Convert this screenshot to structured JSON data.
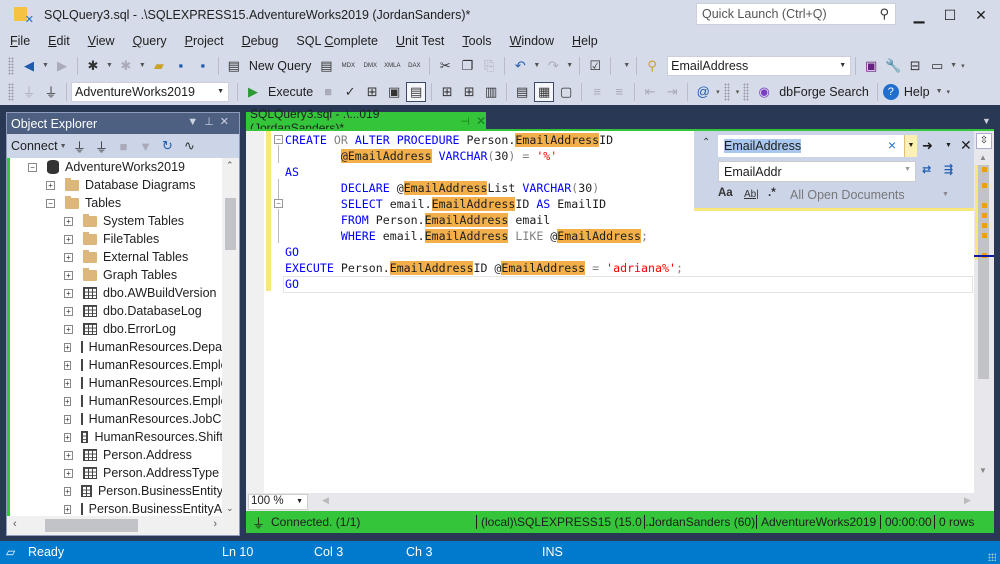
{
  "window": {
    "title": "SQLQuery3.sql - .\\SQLEXPRESS15.AdventureWorks2019 (JordanSanders)*",
    "quick_launch_placeholder": "Quick Launch (Ctrl+Q)",
    "minimize": "▁",
    "maximize": "☐",
    "close": "✕"
  },
  "menu": [
    {
      "label": "File",
      "access": "F",
      "rest": "ile"
    },
    {
      "label": "Edit",
      "access": "E",
      "rest": "dit"
    },
    {
      "label": "View",
      "access": "V",
      "rest": "iew"
    },
    {
      "label": "Query",
      "access": "Q",
      "rest": "uery"
    },
    {
      "label": "Project",
      "access": "P",
      "rest": "roject"
    },
    {
      "label": "Debug",
      "access": "D",
      "rest": "ebug"
    },
    {
      "label": "SQL Complete",
      "pre": "SQL ",
      "access": "C",
      "rest": "omplete"
    },
    {
      "label": "Unit Test",
      "access": "U",
      "rest": "nit Test"
    },
    {
      "label": "Tools",
      "access": "T",
      "rest": "ools"
    },
    {
      "label": "Window",
      "access": "W",
      "rest": "indow"
    },
    {
      "label": "Help",
      "access": "H",
      "rest": "elp"
    }
  ],
  "toolbar1": {
    "new_query": "New Query",
    "find_combo": "EmailAddress",
    "icons": {
      "mdx": "MDX",
      "dmx": "DMX",
      "xmla": "XMLA",
      "dax": "DAX"
    }
  },
  "toolbar2": {
    "database": "AdventureWorks2019",
    "execute": "Execute",
    "dbforge_search": "dbForge Search",
    "help": "Help"
  },
  "object_explorer": {
    "title": "Object Explorer",
    "connect": "Connect",
    "tree": [
      {
        "label": "AdventureWorks2019",
        "level": 0,
        "expander": "−",
        "icon": "database"
      },
      {
        "label": "Database Diagrams",
        "level": 1,
        "expander": "+",
        "icon": "folder"
      },
      {
        "label": "Tables",
        "level": 1,
        "expander": "−",
        "icon": "folder"
      },
      {
        "label": "System Tables",
        "level": 2,
        "expander": "+",
        "icon": "folder"
      },
      {
        "label": "FileTables",
        "level": 2,
        "expander": "+",
        "icon": "folder"
      },
      {
        "label": "External Tables",
        "level": 2,
        "expander": "+",
        "icon": "folder"
      },
      {
        "label": "Graph Tables",
        "level": 2,
        "expander": "+",
        "icon": "folder"
      },
      {
        "label": "dbo.AWBuildVersion",
        "level": 2,
        "expander": "+",
        "icon": "table"
      },
      {
        "label": "dbo.DatabaseLog",
        "level": 2,
        "expander": "+",
        "icon": "table"
      },
      {
        "label": "dbo.ErrorLog",
        "level": 2,
        "expander": "+",
        "icon": "table"
      },
      {
        "label": "HumanResources.Department",
        "level": 2,
        "expander": "+",
        "icon": "table"
      },
      {
        "label": "HumanResources.Employee",
        "level": 2,
        "expander": "+",
        "icon": "table"
      },
      {
        "label": "HumanResources.EmployeeDepartmentHistory",
        "level": 2,
        "expander": "+",
        "icon": "table"
      },
      {
        "label": "HumanResources.EmployeePayHistory",
        "level": 2,
        "expander": "+",
        "icon": "table"
      },
      {
        "label": "HumanResources.JobCandidate",
        "level": 2,
        "expander": "+",
        "icon": "table"
      },
      {
        "label": "HumanResources.Shift",
        "level": 2,
        "expander": "+",
        "icon": "table"
      },
      {
        "label": "Person.Address",
        "level": 2,
        "expander": "+",
        "icon": "table"
      },
      {
        "label": "Person.AddressType",
        "level": 2,
        "expander": "+",
        "icon": "table"
      },
      {
        "label": "Person.BusinessEntity",
        "level": 2,
        "expander": "+",
        "icon": "table"
      },
      {
        "label": "Person.BusinessEntityAddress",
        "level": 2,
        "expander": "+",
        "icon": "table"
      }
    ]
  },
  "document_tab": {
    "label": "SQLQuery3.sql - .\\...019 (JordanSanders)*",
    "pin": "⊣",
    "close": "✕"
  },
  "code_lines": [
    [
      [
        "kw",
        "CREATE"
      ],
      [
        "tx",
        " "
      ],
      [
        "gr",
        "OR"
      ],
      [
        "tx",
        " "
      ],
      [
        "kw",
        "ALTER PROCEDURE"
      ],
      [
        "tx",
        " Person."
      ],
      [
        "hl",
        "EmailAddress"
      ],
      [
        "tx",
        "ID"
      ]
    ],
    [
      [
        "tx",
        "        "
      ],
      [
        "hl",
        "@EmailAddress"
      ],
      [
        "tx",
        " "
      ],
      [
        "kw",
        "VARCHAR"
      ],
      [
        "gr",
        "("
      ],
      [
        "tx",
        "30"
      ],
      [
        "gr",
        ") = "
      ],
      [
        "st",
        "'%'"
      ]
    ],
    [
      [
        "kw",
        "AS"
      ]
    ],
    [
      [
        "tx",
        "        "
      ],
      [
        "kw",
        "DECLARE"
      ],
      [
        "tx",
        " @"
      ],
      [
        "hl",
        "EmailAddress"
      ],
      [
        "tx",
        "List "
      ],
      [
        "kw",
        "VARCHAR"
      ],
      [
        "gr",
        "("
      ],
      [
        "tx",
        "30"
      ],
      [
        "gr",
        ")"
      ]
    ],
    [
      [
        "tx",
        "        "
      ],
      [
        "kw",
        "SELECT"
      ],
      [
        "tx",
        " email."
      ],
      [
        "hl",
        "EmailAddress"
      ],
      [
        "tx",
        "ID "
      ],
      [
        "kw",
        "AS"
      ],
      [
        "tx",
        " EmailID"
      ]
    ],
    [
      [
        "tx",
        "        "
      ],
      [
        "kw",
        "FROM"
      ],
      [
        "tx",
        " Person."
      ],
      [
        "hl",
        "EmailAddress"
      ],
      [
        "tx",
        " email"
      ]
    ],
    [
      [
        "tx",
        "        "
      ],
      [
        "kw",
        "WHERE"
      ],
      [
        "tx",
        " email."
      ],
      [
        "hl",
        "EmailAddress"
      ],
      [
        "tx",
        " "
      ],
      [
        "gr",
        "LIKE"
      ],
      [
        "tx",
        " @"
      ],
      [
        "hl",
        "EmailAddress"
      ],
      [
        "gr",
        ";"
      ]
    ],
    [
      [
        "kw",
        "GO"
      ]
    ],
    [
      [
        "kw",
        "EXECUTE"
      ],
      [
        "tx",
        " Person."
      ],
      [
        "hl",
        "EmailAddress"
      ],
      [
        "tx",
        "ID @"
      ],
      [
        "hl",
        "EmailAddress"
      ],
      [
        "gr",
        " = "
      ],
      [
        "st",
        "'adriana%'"
      ],
      [
        "gr",
        ";"
      ]
    ],
    [
      [
        "kw",
        "GO"
      ]
    ]
  ],
  "find_replace": {
    "find_value": "EmailAddress",
    "replace_value": "EmailAddr",
    "scope": "All Open Documents",
    "match_case": "Aa",
    "whole_word": "Ab|",
    "regex": ".*"
  },
  "editor_footer": {
    "zoom": "100 %"
  },
  "query_status": {
    "connected": "Connected. (1/1)",
    "server": "(local)\\SQLEXPRESS15 (15.0 ...",
    "user": "JordanSanders (60)",
    "database": "AdventureWorks2019",
    "elapsed": "00:00:00",
    "rows": "0 rows"
  },
  "status_bar": {
    "ready": "Ready",
    "line": "Ln 10",
    "col": "Col 3",
    "ch": "Ch 3",
    "mode": "INS"
  },
  "colors": {
    "accent_green": "#34c53a",
    "status_blue": "#007acc",
    "highlight": "#f3b04a",
    "chrome": "#d6dbe9",
    "dark_frame": "#293955"
  }
}
